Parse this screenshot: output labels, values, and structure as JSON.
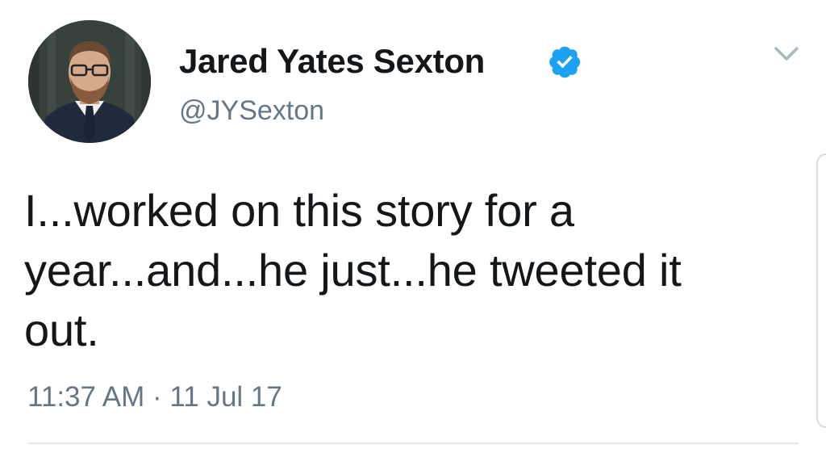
{
  "author": {
    "display_name": "Jared Yates Sexton",
    "handle": "@JYSexton",
    "verified": true,
    "avatar_icon": "profile-photo-man-glasses-beard-suit"
  },
  "tweet": {
    "lines": [
      "I...worked on this story for a",
      "year...and...he just...he tweeted it",
      "out."
    ],
    "timestamp": "11:37 AM · 11 Jul 17"
  },
  "menu": {
    "icon": "chevron-down-icon"
  },
  "colors": {
    "text": "#14171a",
    "secondary": "#657786",
    "verified_blue": "#1da1f2",
    "divider": "#e1e8ed"
  }
}
